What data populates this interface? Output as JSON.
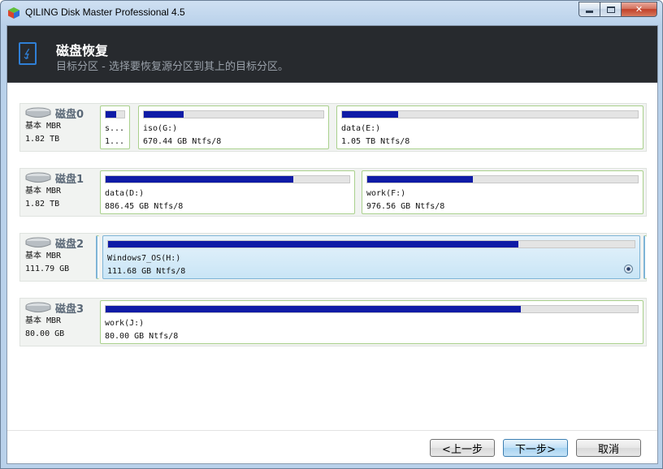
{
  "window": {
    "title": "QILING Disk Master Professional 4.5"
  },
  "header": {
    "title": "磁盘恢复",
    "subtitle": "目标分区 - 选择要恢复源分区到其上的目标分区。"
  },
  "disks": [
    {
      "name": "磁盘0",
      "type": "基本 MBR",
      "size": "1.82 TB",
      "partitions": [
        {
          "label": "s...",
          "size": "1...",
          "used": 0.55
        },
        {
          "label": "iso(G:)",
          "size": "670.44 GB Ntfs/8",
          "used": 0.22
        },
        {
          "label": "data(E:)",
          "size": "1.05 TB Ntfs/8",
          "used": 0.19
        }
      ]
    },
    {
      "name": "磁盘1",
      "type": "基本 MBR",
      "size": "1.82 TB",
      "partitions": [
        {
          "label": "data(D:)",
          "size": "886.45 GB Ntfs/8",
          "used": 0.77
        },
        {
          "label": "work(F:)",
          "size": "976.56 GB Ntfs/8",
          "used": 0.39
        }
      ]
    },
    {
      "name": "磁盘2",
      "type": "基本 MBR",
      "size": "111.79 GB",
      "partitions": [
        {
          "label": "Windows7_OS(H:)",
          "size": "111.68 GB Ntfs/8",
          "used": 0.78,
          "selected": true
        }
      ]
    },
    {
      "name": "磁盘3",
      "type": "基本 MBR",
      "size": "80.00 GB",
      "partitions": [
        {
          "label": "work(J:)",
          "size": "80.00 GB Ntfs/8",
          "used": 0.78
        }
      ]
    }
  ],
  "buttons": {
    "back": "<上一步",
    "next": "下一步>",
    "cancel": "取消"
  },
  "colors": {
    "header_bg": "#272a2e",
    "usage_fill": "#0f1ba6",
    "partition_border": "#a9d08c",
    "selected_bg": "#c9e5f6"
  }
}
